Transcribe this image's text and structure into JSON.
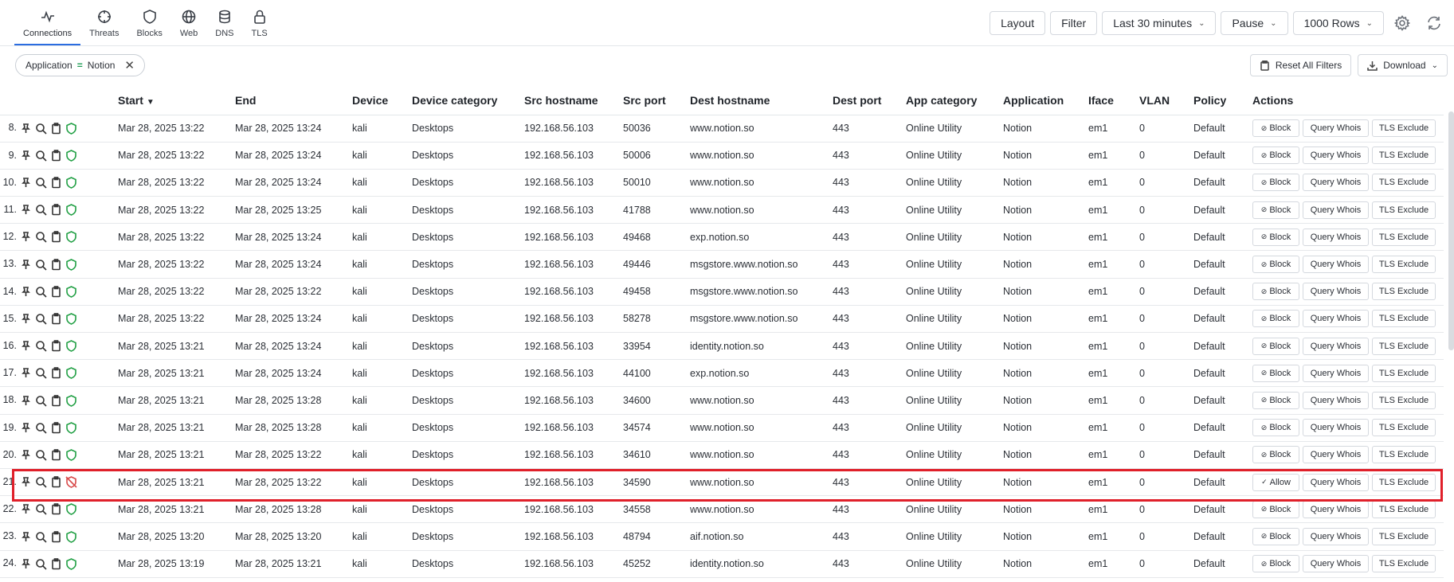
{
  "nav": {
    "tabs": [
      {
        "label": "Connections",
        "icon": "activity-icon",
        "active": true
      },
      {
        "label": "Threats",
        "icon": "crosshair-icon"
      },
      {
        "label": "Blocks",
        "icon": "shield-icon"
      },
      {
        "label": "Web",
        "icon": "globe-icon"
      },
      {
        "label": "DNS",
        "icon": "database-icon"
      },
      {
        "label": "TLS",
        "icon": "lock-icon"
      }
    ]
  },
  "toolbar": {
    "layout": "Layout",
    "filter": "Filter",
    "time_range": "Last 30 minutes",
    "pause": "Pause",
    "rows": "1000 Rows"
  },
  "filterbar": {
    "chip_field": "Application",
    "chip_op": "=",
    "chip_value": "Notion",
    "reset": "Reset All Filters",
    "download": "Download"
  },
  "columns": [
    "Start",
    "End",
    "Device",
    "Device category",
    "Src hostname",
    "Src port",
    "Dest hostname",
    "Dest port",
    "App category",
    "Application",
    "Iface",
    "VLAN",
    "Policy",
    "Actions"
  ],
  "actions": {
    "block": "Block",
    "allow": "Allow",
    "whois": "Query Whois",
    "tls": "TLS Exclude"
  },
  "rows": [
    {
      "n": "8.",
      "start": "Mar 28, 2025 13:22",
      "end": "Mar 28, 2025 13:24",
      "device": "kali",
      "cat": "Desktops",
      "src": "192.168.56.103",
      "sport": "50036",
      "dest": "www.notion.so",
      "dport": "443",
      "appcat": "Online Utility",
      "app": "Notion",
      "iface": "em1",
      "vlan": "0",
      "policy": "Default",
      "blocked": false
    },
    {
      "n": "9.",
      "start": "Mar 28, 2025 13:22",
      "end": "Mar 28, 2025 13:24",
      "device": "kali",
      "cat": "Desktops",
      "src": "192.168.56.103",
      "sport": "50006",
      "dest": "www.notion.so",
      "dport": "443",
      "appcat": "Online Utility",
      "app": "Notion",
      "iface": "em1",
      "vlan": "0",
      "policy": "Default",
      "blocked": false
    },
    {
      "n": "10.",
      "start": "Mar 28, 2025 13:22",
      "end": "Mar 28, 2025 13:24",
      "device": "kali",
      "cat": "Desktops",
      "src": "192.168.56.103",
      "sport": "50010",
      "dest": "www.notion.so",
      "dport": "443",
      "appcat": "Online Utility",
      "app": "Notion",
      "iface": "em1",
      "vlan": "0",
      "policy": "Default",
      "blocked": false
    },
    {
      "n": "11.",
      "start": "Mar 28, 2025 13:22",
      "end": "Mar 28, 2025 13:25",
      "device": "kali",
      "cat": "Desktops",
      "src": "192.168.56.103",
      "sport": "41788",
      "dest": "www.notion.so",
      "dport": "443",
      "appcat": "Online Utility",
      "app": "Notion",
      "iface": "em1",
      "vlan": "0",
      "policy": "Default",
      "blocked": false
    },
    {
      "n": "12.",
      "start": "Mar 28, 2025 13:22",
      "end": "Mar 28, 2025 13:24",
      "device": "kali",
      "cat": "Desktops",
      "src": "192.168.56.103",
      "sport": "49468",
      "dest": "exp.notion.so",
      "dport": "443",
      "appcat": "Online Utility",
      "app": "Notion",
      "iface": "em1",
      "vlan": "0",
      "policy": "Default",
      "blocked": false
    },
    {
      "n": "13.",
      "start": "Mar 28, 2025 13:22",
      "end": "Mar 28, 2025 13:24",
      "device": "kali",
      "cat": "Desktops",
      "src": "192.168.56.103",
      "sport": "49446",
      "dest": "msgstore.www.notion.so",
      "dport": "443",
      "appcat": "Online Utility",
      "app": "Notion",
      "iface": "em1",
      "vlan": "0",
      "policy": "Default",
      "blocked": false
    },
    {
      "n": "14.",
      "start": "Mar 28, 2025 13:22",
      "end": "Mar 28, 2025 13:22",
      "device": "kali",
      "cat": "Desktops",
      "src": "192.168.56.103",
      "sport": "49458",
      "dest": "msgstore.www.notion.so",
      "dport": "443",
      "appcat": "Online Utility",
      "app": "Notion",
      "iface": "em1",
      "vlan": "0",
      "policy": "Default",
      "blocked": false
    },
    {
      "n": "15.",
      "start": "Mar 28, 2025 13:22",
      "end": "Mar 28, 2025 13:24",
      "device": "kali",
      "cat": "Desktops",
      "src": "192.168.56.103",
      "sport": "58278",
      "dest": "msgstore.www.notion.so",
      "dport": "443",
      "appcat": "Online Utility",
      "app": "Notion",
      "iface": "em1",
      "vlan": "0",
      "policy": "Default",
      "blocked": false
    },
    {
      "n": "16.",
      "start": "Mar 28, 2025 13:21",
      "end": "Mar 28, 2025 13:24",
      "device": "kali",
      "cat": "Desktops",
      "src": "192.168.56.103",
      "sport": "33954",
      "dest": "identity.notion.so",
      "dport": "443",
      "appcat": "Online Utility",
      "app": "Notion",
      "iface": "em1",
      "vlan": "0",
      "policy": "Default",
      "blocked": false
    },
    {
      "n": "17.",
      "start": "Mar 28, 2025 13:21",
      "end": "Mar 28, 2025 13:24",
      "device": "kali",
      "cat": "Desktops",
      "src": "192.168.56.103",
      "sport": "44100",
      "dest": "exp.notion.so",
      "dport": "443",
      "appcat": "Online Utility",
      "app": "Notion",
      "iface": "em1",
      "vlan": "0",
      "policy": "Default",
      "blocked": false
    },
    {
      "n": "18.",
      "start": "Mar 28, 2025 13:21",
      "end": "Mar 28, 2025 13:28",
      "device": "kali",
      "cat": "Desktops",
      "src": "192.168.56.103",
      "sport": "34600",
      "dest": "www.notion.so",
      "dport": "443",
      "appcat": "Online Utility",
      "app": "Notion",
      "iface": "em1",
      "vlan": "0",
      "policy": "Default",
      "blocked": false
    },
    {
      "n": "19.",
      "start": "Mar 28, 2025 13:21",
      "end": "Mar 28, 2025 13:28",
      "device": "kali",
      "cat": "Desktops",
      "src": "192.168.56.103",
      "sport": "34574",
      "dest": "www.notion.so",
      "dport": "443",
      "appcat": "Online Utility",
      "app": "Notion",
      "iface": "em1",
      "vlan": "0",
      "policy": "Default",
      "blocked": false
    },
    {
      "n": "20.",
      "start": "Mar 28, 2025 13:21",
      "end": "Mar 28, 2025 13:22",
      "device": "kali",
      "cat": "Desktops",
      "src": "192.168.56.103",
      "sport": "34610",
      "dest": "www.notion.so",
      "dport": "443",
      "appcat": "Online Utility",
      "app": "Notion",
      "iface": "em1",
      "vlan": "0",
      "policy": "Default",
      "blocked": false
    },
    {
      "n": "21.",
      "start": "Mar 28, 2025 13:21",
      "end": "Mar 28, 2025 13:22",
      "device": "kali",
      "cat": "Desktops",
      "src": "192.168.56.103",
      "sport": "34590",
      "dest": "www.notion.so",
      "dport": "443",
      "appcat": "Online Utility",
      "app": "Notion",
      "iface": "em1",
      "vlan": "0",
      "policy": "Default",
      "blocked": true
    },
    {
      "n": "22.",
      "start": "Mar 28, 2025 13:21",
      "end": "Mar 28, 2025 13:28",
      "device": "kali",
      "cat": "Desktops",
      "src": "192.168.56.103",
      "sport": "34558",
      "dest": "www.notion.so",
      "dport": "443",
      "appcat": "Online Utility",
      "app": "Notion",
      "iface": "em1",
      "vlan": "0",
      "policy": "Default",
      "blocked": false
    },
    {
      "n": "23.",
      "start": "Mar 28, 2025 13:20",
      "end": "Mar 28, 2025 13:20",
      "device": "kali",
      "cat": "Desktops",
      "src": "192.168.56.103",
      "sport": "48794",
      "dest": "aif.notion.so",
      "dport": "443",
      "appcat": "Online Utility",
      "app": "Notion",
      "iface": "em1",
      "vlan": "0",
      "policy": "Default",
      "blocked": false
    },
    {
      "n": "24.",
      "start": "Mar 28, 2025 13:19",
      "end": "Mar 28, 2025 13:21",
      "device": "kali",
      "cat": "Desktops",
      "src": "192.168.56.103",
      "sport": "45252",
      "dest": "identity.notion.so",
      "dport": "443",
      "appcat": "Online Utility",
      "app": "Notion",
      "iface": "em1",
      "vlan": "0",
      "policy": "Default",
      "blocked": false
    }
  ]
}
